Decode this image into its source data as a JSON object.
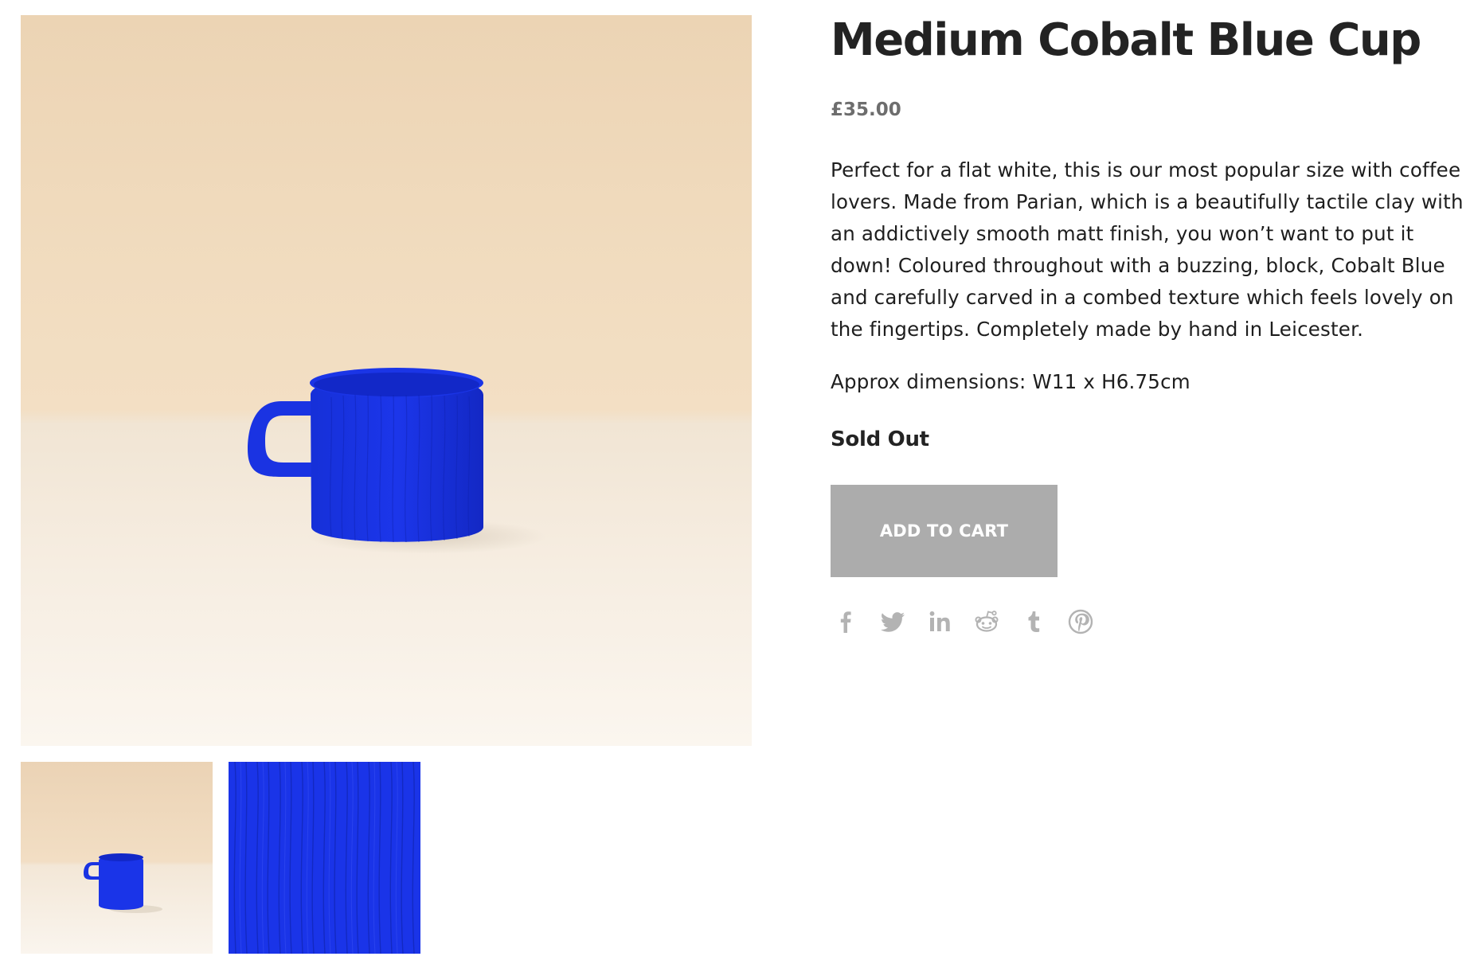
{
  "product": {
    "title": "Medium Cobalt Blue Cup",
    "price": "£35.00",
    "description": "Perfect for a flat white, this is our most popular size with coffee lovers. Made from Parian, which is a beautifully tactile clay with an addictively smooth matt finish, you won’t want to put it down! Coloured throughout with a buzzing, block, Cobalt Blue and carefully carved in a combed texture which feels lovely on the fingertips. Completely made by hand in Leicester.",
    "dimensions": "Approx dimensions: W11 x H6.75cm",
    "stock_status": "Sold Out",
    "add_to_cart_label": "ADD TO CART"
  },
  "gallery": {
    "main_image": "cobalt-blue-cup-photo",
    "thumbnails": [
      "cup-on-table-thumbnail",
      "combed-texture-closeup-thumbnail"
    ]
  },
  "share_icons": [
    "facebook-icon",
    "twitter-icon",
    "linkedin-icon",
    "reddit-icon",
    "tumblr-icon",
    "pinterest-icon"
  ],
  "colors": {
    "cup_blue": "#1a34e8",
    "button_disabled": "#acacac",
    "icon_gray": "#b3b3b3",
    "price_gray": "#6d6d6d"
  }
}
